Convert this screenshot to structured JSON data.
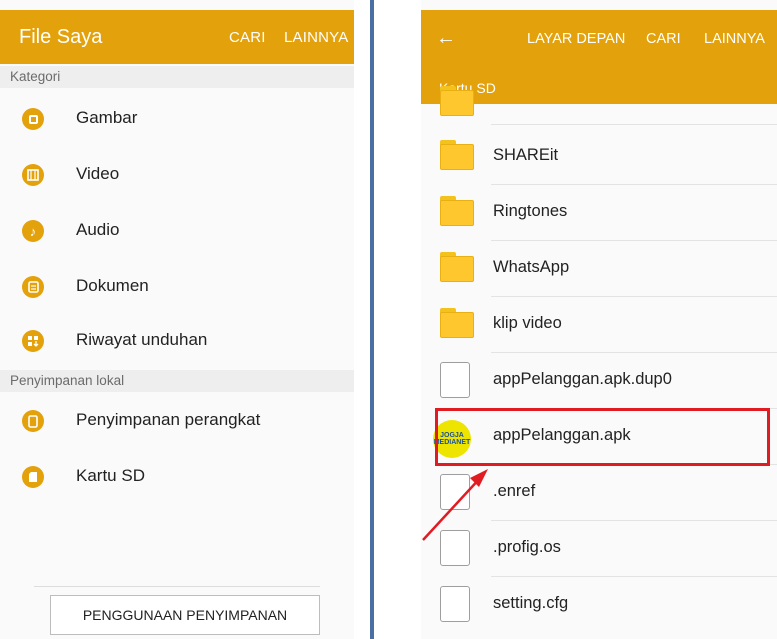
{
  "left_panel": {
    "title": "File Saya",
    "actions": [
      "CARI",
      "LAINNYA"
    ],
    "section_kategori": "Kategori",
    "kategori_items": [
      {
        "label": "Gambar",
        "icon": "image-icon"
      },
      {
        "label": "Video",
        "icon": "film-icon"
      },
      {
        "label": "Audio",
        "icon": "music-note-icon"
      },
      {
        "label": "Dokumen",
        "icon": "document-icon"
      },
      {
        "label": "Riwayat unduhan",
        "icon": "download-history-icon"
      }
    ],
    "section_lokal": "Penyimpanan lokal",
    "lokal_items": [
      {
        "label": "Penyimpanan perangkat",
        "icon": "phone-storage-icon"
      },
      {
        "label": "Kartu SD",
        "icon": "sd-card-icon"
      }
    ],
    "storage_button": "PENGGUNAAN PENYIMPANAN"
  },
  "right_panel": {
    "back_icon": "arrow-left-icon",
    "actions": [
      "LAYAR DEPAN",
      "CARI",
      "LAINNYA"
    ],
    "breadcrumb": "Kartu SD",
    "files": [
      {
        "label": "SHAREit",
        "type": "folder"
      },
      {
        "label": "Ringtones",
        "type": "folder"
      },
      {
        "label": "WhatsApp",
        "type": "folder"
      },
      {
        "label": "klip video",
        "type": "folder"
      },
      {
        "label": "appPelanggan.apk.dup0",
        "type": "file"
      },
      {
        "label": "appPelanggan.apk",
        "type": "apk",
        "icon_text": "JOGJA MEDIANET"
      },
      {
        "label": ".enref",
        "type": "file"
      },
      {
        "label": ".profig.os",
        "type": "file"
      },
      {
        "label": "setting.cfg",
        "type": "file"
      }
    ]
  },
  "colors": {
    "accent": "#e3a10b",
    "highlight": "#e11b22",
    "folder": "#fec72d"
  }
}
